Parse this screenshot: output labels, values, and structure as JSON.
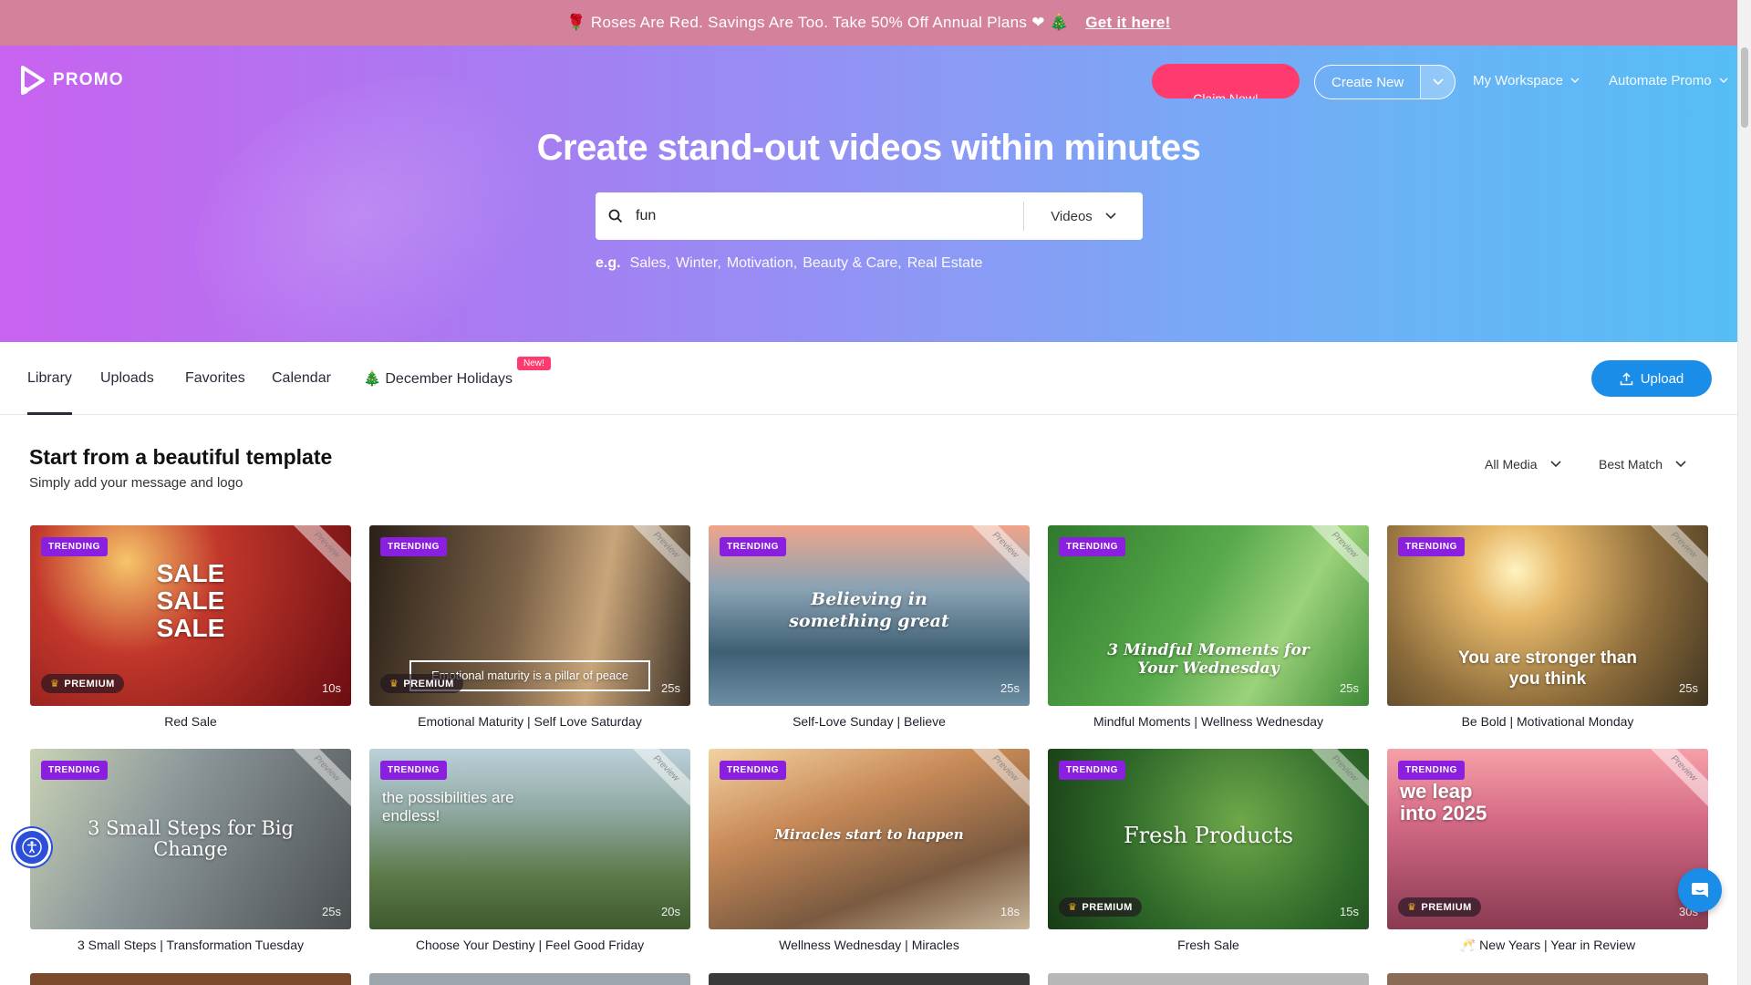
{
  "promo_bar": {
    "emoji_left": "🌹",
    "text": "Roses Are Red. Savings Are Too. Take 50% Off Annual Plans ❤",
    "emoji_right": "🎄",
    "cta": "Get it here!"
  },
  "header": {
    "logo": "PROMO",
    "claim_button": "Claim Now!",
    "create_button": "Create New",
    "nav": [
      "My Workspace",
      "Automate Promo"
    ]
  },
  "hero": {
    "title": "Create stand-out videos within minutes",
    "search_value": "fun",
    "search_type": "Videos",
    "eg_label": "e.g.",
    "suggestions": [
      "Sales,",
      "Winter,",
      "Motivation,",
      "Beauty & Care,",
      "Real Estate"
    ]
  },
  "tabs": {
    "items": [
      "Library",
      "Uploads",
      "Favorites",
      "Calendar",
      "🎄 December Holidays"
    ],
    "new_badge": "New!",
    "upload_button": "Upload"
  },
  "section": {
    "title": "Start from a beautiful template",
    "subtitle": "Simply add your message and logo",
    "filter_media": "All Media",
    "filter_sort": "Best Match"
  },
  "labels": {
    "trending": "TRENDING",
    "premium": "PREMIUM",
    "preview": "Preview"
  },
  "templates": [
    {
      "name": "Red Sale",
      "duration": "10s",
      "premium": true,
      "text": "SALE\nSALE\nSALE",
      "bg": "#a81c1c"
    },
    {
      "name": "Emotional Maturity | Self Love Saturday",
      "duration": "25s",
      "premium": true,
      "text": "Emotional maturity is a pillar of peace",
      "bg": "#5b4a38"
    },
    {
      "name": "Self-Love Sunday | Believe",
      "duration": "25s",
      "premium": false,
      "text": "Believing in something great",
      "bg": "#4e6f86"
    },
    {
      "name": "Mindful Moments | Wellness Wednesday",
      "duration": "25s",
      "premium": false,
      "text": "3 Mindful Moments for Your Wednesday",
      "bg": "#3f8a36"
    },
    {
      "name": "Be Bold | Motivational Monday",
      "duration": "25s",
      "premium": false,
      "text": "You are stronger than you think",
      "bg": "#8a6a3a"
    },
    {
      "name": "3 Small Steps | Transformation Tuesday",
      "duration": "25s",
      "premium": false,
      "text": "3 Small Steps for Big Change",
      "bg": "#7d8890"
    },
    {
      "name": "Choose Your Destiny | Feel Good Friday",
      "duration": "20s",
      "premium": false,
      "text": "the possibilities are endless!",
      "bg": "#6f8a70"
    },
    {
      "name": "Wellness Wednesday | Miracles",
      "duration": "18s",
      "premium": false,
      "text": "Miracles start to happen",
      "bg": "#b0734a"
    },
    {
      "name": "Fresh Sale",
      "duration": "15s",
      "premium": true,
      "text": "Fresh Products",
      "bg": "#2f6a2a"
    },
    {
      "name": "🥂 New Years | Year in Review",
      "duration": "30s",
      "premium": true,
      "text": "we leap into 2025",
      "bg": "#c25a78"
    }
  ],
  "colors": {
    "accent_pink": "#ff3a6e",
    "upload_blue": "#1a8de9",
    "trending_purple": "#8a1fe0",
    "promo_bar": "#d4829c"
  }
}
